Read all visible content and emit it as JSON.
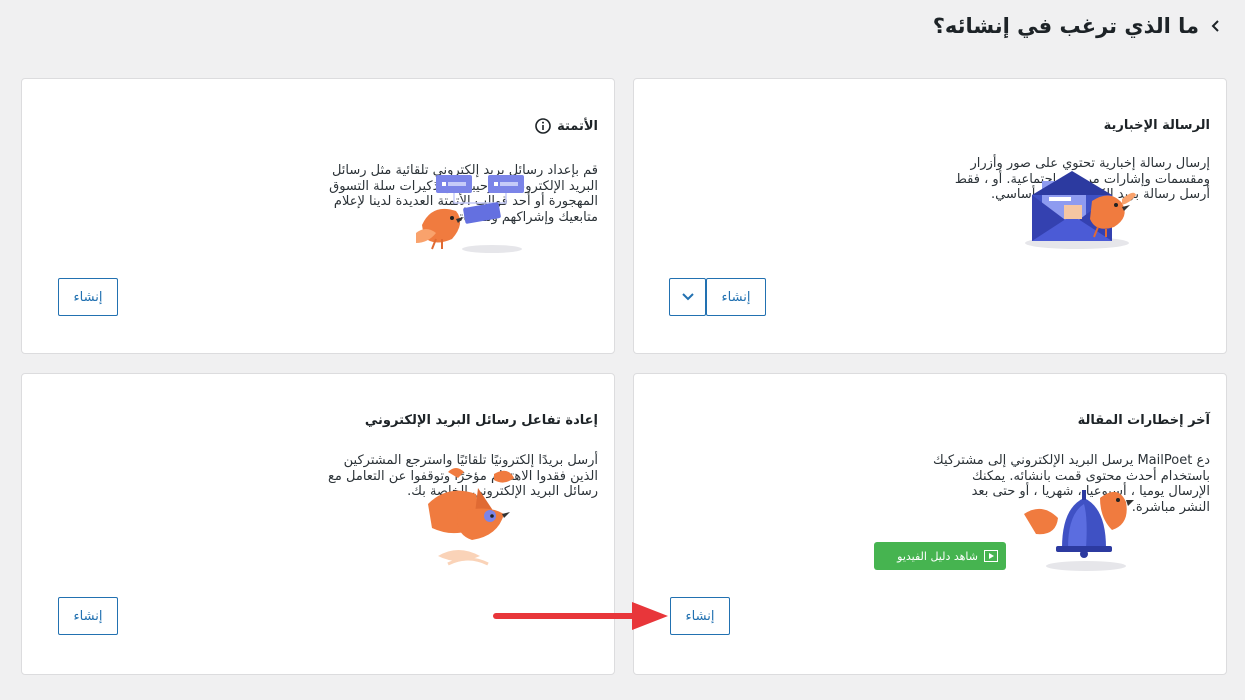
{
  "header": {
    "title": "ما الذي ترغب في إنشائه؟"
  },
  "cards": {
    "newsletter": {
      "title": "الرسالة الإخبارية",
      "desc_lines": [
        "إرسال رسالة إخبارية تحتوي على صور وأزرار",
        "ومقسمات وإشارات مرجعية اجتماعية. أو ، فقط",
        "أرسل رسالة بريد إلكتروني بنص أساسي."
      ],
      "button": "إنشاء"
    },
    "automation": {
      "title": "الأتمتة",
      "desc_lines": [
        "قم بإعداد رسائل بريد إلكتروني تلقائية مثل رسائل",
        "البريد الإلكتروني الترحيبية أو تذكيرات سلة التسوق",
        "المهجورة أو أحد قوالب الأتمتة العديدة لدينا لإعلام",
        "متابعيك وإشراكهم ومكافأتهم."
      ],
      "button": "إنشاء"
    },
    "post_notifications": {
      "title": "آخر إخطارات المقالة",
      "desc_lines": [
        "دع MailPoet يرسل البريد الإلكتروني إلى مشتركيك",
        "باستخدام أحدث محتوى قمت بانشائه. يمكنك",
        "الإرسال يوميا ، أسبوعيا ، شهريا ، أو حتى بعد",
        "النشر مباشرة."
      ],
      "video_button": "شاهد دليل الفيديو",
      "button": "إنشاء"
    },
    "reengagement": {
      "title": "إعادة تفاعل رسائل البريد الإلكتروني",
      "desc_lines": [
        "أرسل بريدًا إلكترونيًا تلقائيًا واسترجع المشتركين",
        "الذين فقدوا الاهتمام مؤخرًا وتوقفوا عن التعامل مع",
        "رسائل البريد الإلكتروني الخاصة بك."
      ],
      "button": "إنشاء"
    }
  },
  "colors": {
    "accent": "#2271b1",
    "green": "#46b450",
    "arrow": "#e8363a",
    "orange": "#f07b3f",
    "purple": "#7b84e8",
    "blue": "#3f51c4"
  }
}
